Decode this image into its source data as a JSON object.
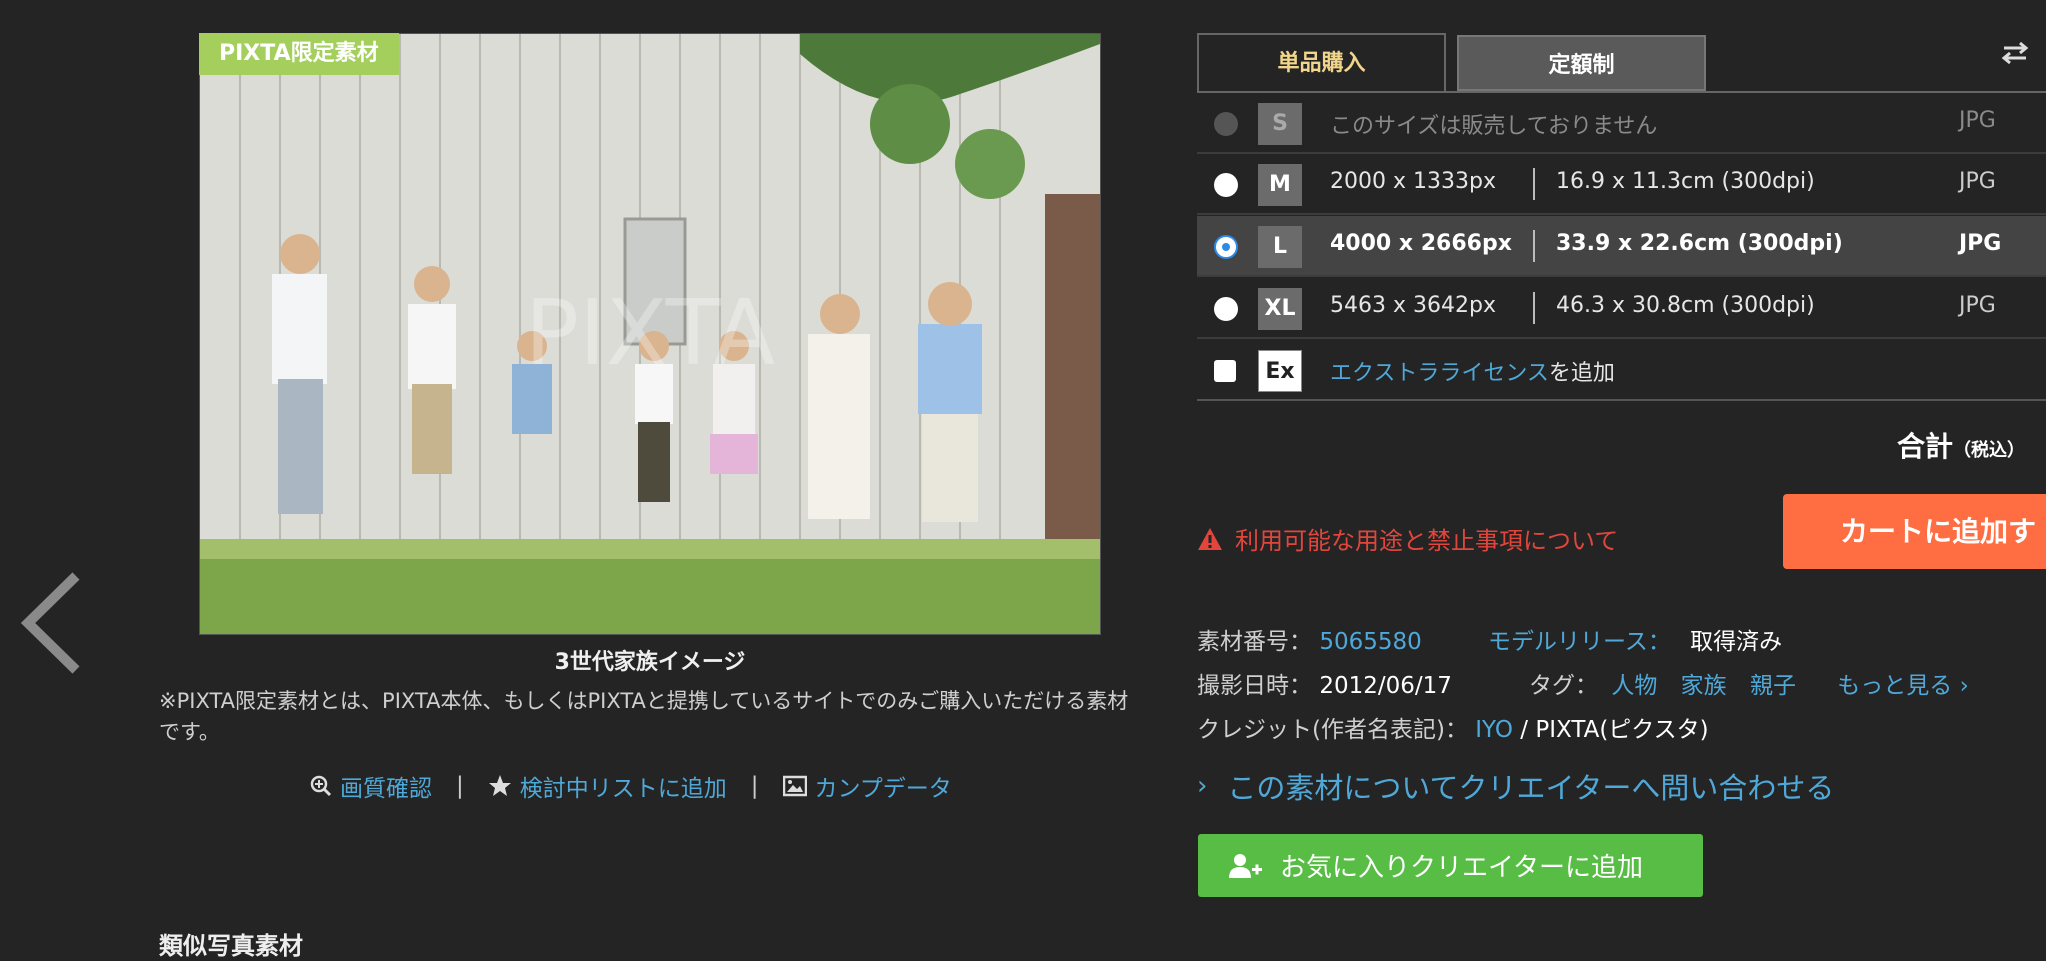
{
  "photo": {
    "badge": "PIXTA限定素材",
    "watermark": "PIXTA",
    "caption": "3世代家族イメージ",
    "note": "※PIXTA限定素材とは、PIXTA本体、もしくはPIXTAと提携しているサイトでのみご購入いただける素材です。"
  },
  "tools": {
    "quality": "画質確認",
    "wishlist": "検討中リストに追加",
    "comp": "カンプデータ"
  },
  "similar_heading": "類似写真素材",
  "tabs": {
    "single": "単品購入",
    "subscription": "定額制"
  },
  "sizes": [
    {
      "code": "S",
      "px": "このサイズは販売しておりません",
      "cm": "",
      "format": "JPG",
      "state": "disabled"
    },
    {
      "code": "M",
      "px": "2000 x 1333px",
      "cm": "16.9 x 11.3cm (300dpi)",
      "format": "JPG",
      "state": "unchecked"
    },
    {
      "code": "L",
      "px": "4000 x 2666px",
      "cm": "33.9 x 22.6cm (300dpi)",
      "format": "JPG",
      "state": "checked"
    },
    {
      "code": "XL",
      "px": "5463 x 3642px",
      "cm": "46.3 x 30.8cm (300dpi)",
      "format": "JPG",
      "state": "unchecked"
    }
  ],
  "extra": {
    "code": "Ex",
    "link": "エクストラライセンス",
    "suffix": "を追加"
  },
  "total": {
    "label": "合計",
    "tax": "（税込）"
  },
  "warning": "利用可能な用途と禁止事項について",
  "cart_button": "カートに追加す",
  "meta": {
    "id_label": "素材番号：",
    "id_value": "5065580",
    "release_label": "モデルリリース：",
    "release_value": "取得済み",
    "date_label": "撮影日時：",
    "date_value": "2012/06/17",
    "tag_label": "タグ：",
    "tags": [
      "人物",
      "家族",
      "親子"
    ],
    "more": "もっと見る",
    "credit_label": "クレジット(作者名表記)：",
    "credit_author": "IYO",
    "credit_sep": "/",
    "credit_site": "PIXTA(ピクスタ)"
  },
  "inquire": "この素材についてクリエイターへ問い合わせる",
  "fav_button": "お気に入りクリエイターに追加",
  "colors": {
    "accent_link": "#4fa8d8",
    "cart": "#ff6e42",
    "fav": "#58bd45",
    "warning": "#e0463c",
    "badge": "#a4cf5c"
  }
}
